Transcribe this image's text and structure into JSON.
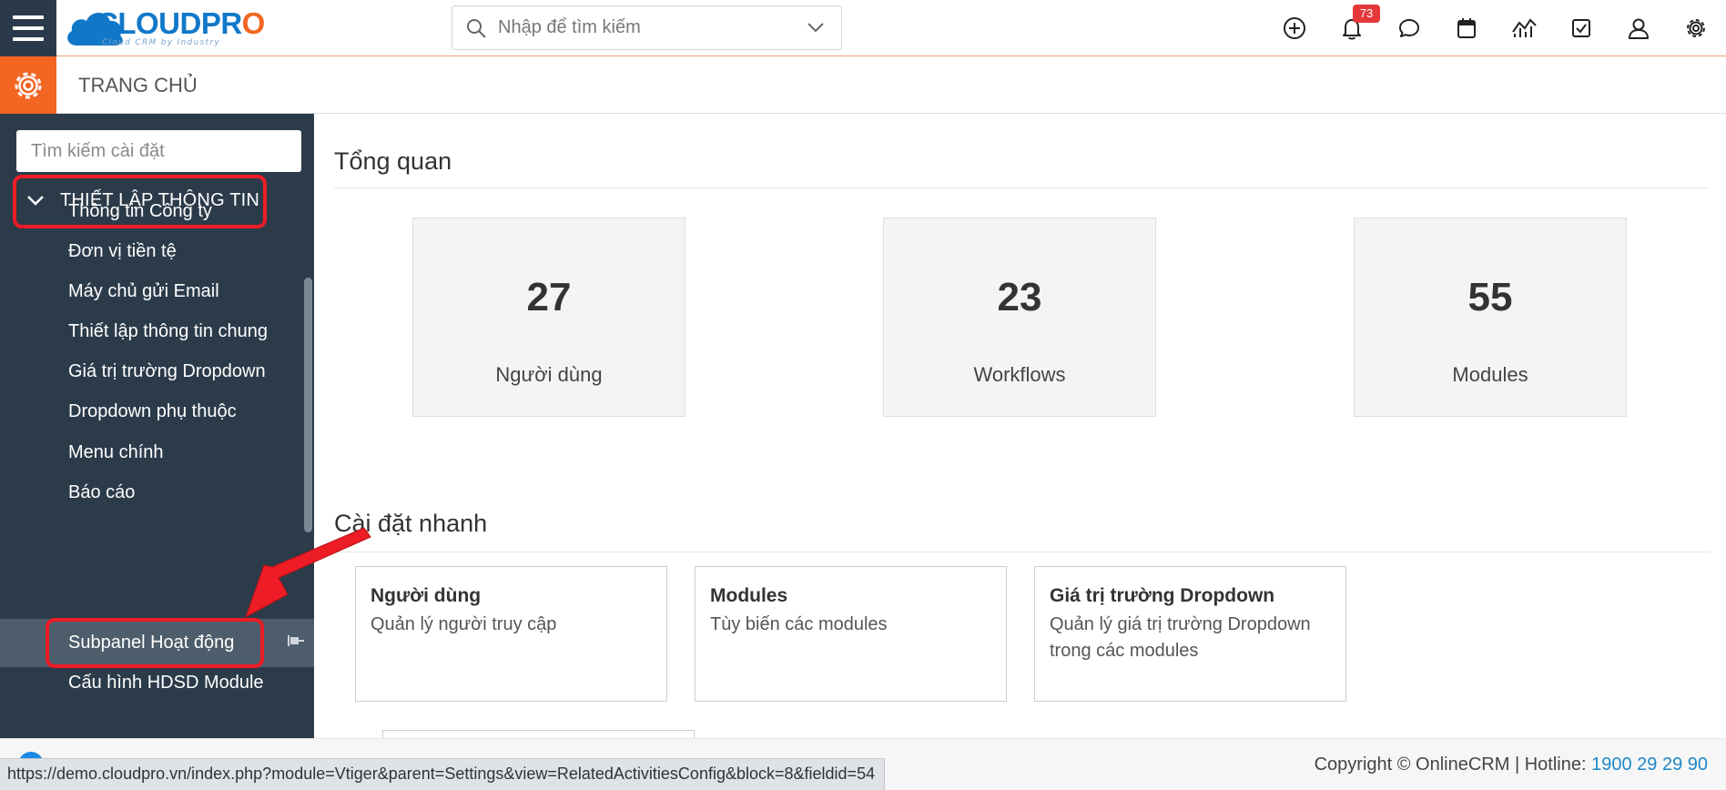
{
  "header": {
    "logo_text": "CLOUDPRO",
    "logo_tagline": "Cloud CRM by Industry",
    "search_placeholder": "Nhập để tìm kiếm",
    "notification_count": "73",
    "colors": {
      "nav_dark": "#2a3a4a",
      "brand_blue": "#1178c8",
      "brand_orange": "#f26522"
    }
  },
  "subheader": {
    "title": "TRANG CHỦ"
  },
  "sidebar": {
    "search_placeholder": "Tìm kiếm cài đặt",
    "section_label": "THIẾT LẬP THÔNG TIN",
    "items": [
      {
        "label": "Thông tin Công ty"
      },
      {
        "label": "Đơn vị tiền tệ"
      },
      {
        "label": "Máy chủ gửi Email"
      },
      {
        "label": "Thiết lập thông tin chung"
      },
      {
        "label": "Giá trị trường Dropdown"
      },
      {
        "label": "Dropdown phụ thuộc"
      },
      {
        "label": "Menu chính"
      },
      {
        "label": "Báo cáo"
      },
      {
        "label": "Subpanel Hoạt động",
        "active": true
      },
      {
        "label": "Cấu hình HDSD Module"
      }
    ]
  },
  "main": {
    "overview_title": "Tổng quan",
    "stats": [
      {
        "value": "27",
        "label": "Người dùng"
      },
      {
        "value": "23",
        "label": "Workflows"
      },
      {
        "value": "55",
        "label": "Modules"
      }
    ],
    "quick_title": "Cài đặt nhanh",
    "quick_links": [
      {
        "title": "Người dùng",
        "desc": "Quản lý người truy cập"
      },
      {
        "title": "Modules",
        "desc": "Tùy biến các modules"
      },
      {
        "title": "Giá trị trường Dropdown",
        "desc": "Quản lý giá trị trường Dropdown trong các modules"
      }
    ]
  },
  "footer": {
    "copyright": "Copyright © OnlineCRM | Hotline: ",
    "hotline": "1900 29 29 90"
  },
  "status_bar_url": "https://demo.cloudpro.vn/index.php?module=Vtiger&parent=Settings&view=RelatedActivitiesConfig&block=8&fieldid=54"
}
